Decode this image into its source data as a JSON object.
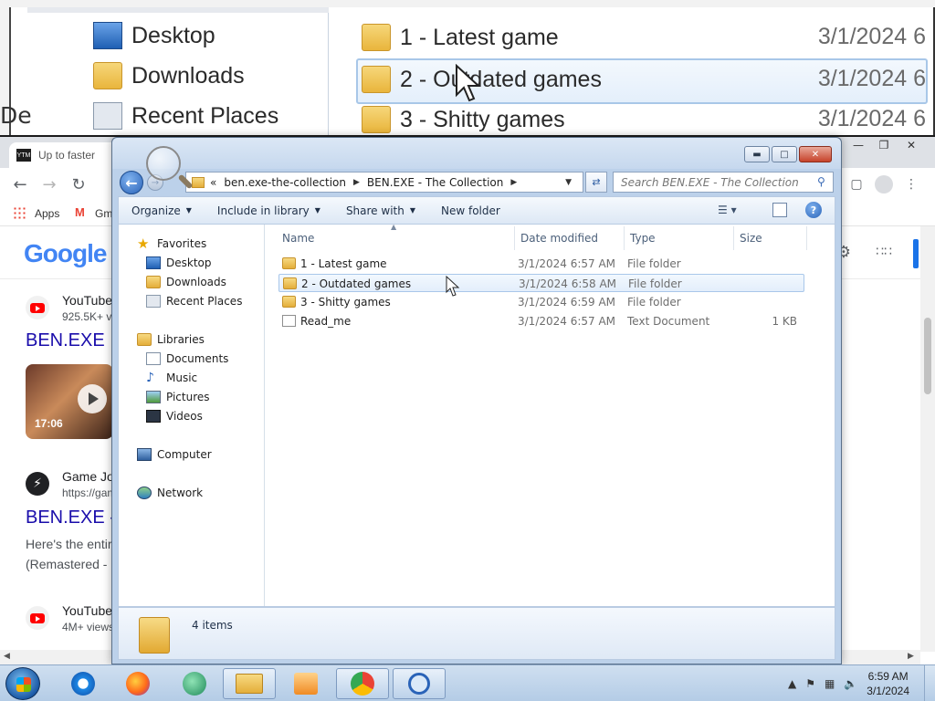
{
  "zoom": {
    "nav_items": [
      "Desktop",
      "Downloads",
      "Recent Places"
    ],
    "files": [
      "1 - Latest game",
      "2 - Outdated games",
      "3 - Shitty games"
    ],
    "date_fragment": "3/1/2024 6",
    "left_fragment": "De"
  },
  "browser": {
    "tab_title": "Up to faster",
    "tab_favicon": "YTM",
    "bookmarks": [
      "Apps",
      "Gm"
    ],
    "google_logo": "Google",
    "results": {
      "r1_source": "YouTube",
      "r1_meta": "925.5K+ v",
      "r1_title": "BEN.EXE",
      "video_duration": "17:06",
      "r2_source": "Game Jo",
      "r2_url": "https://gam",
      "r2_title": "BEN.EXE -",
      "r2_snippet1": "Here's the entir",
      "r2_snippet2": "(Remastered -",
      "r3_source": "YouTube",
      "r3_meta": "4M+ views"
    }
  },
  "explorer": {
    "breadcrumb": [
      "«",
      "ben.exe-the-collection",
      "BEN.EXE - The Collection"
    ],
    "search_placeholder": "Search BEN.EXE - The Collection",
    "toolbar": {
      "organize": "Organize",
      "include": "Include in library",
      "share": "Share with",
      "new_folder": "New folder"
    },
    "nav": {
      "favorites": "Favorites",
      "desktop": "Desktop",
      "downloads": "Downloads",
      "recent": "Recent Places",
      "libraries": "Libraries",
      "documents": "Documents",
      "music": "Music",
      "pictures": "Pictures",
      "videos": "Videos",
      "computer": "Computer",
      "network": "Network"
    },
    "columns": {
      "name": "Name",
      "date": "Date modified",
      "type": "Type",
      "size": "Size"
    },
    "files": [
      {
        "name": "1 - Latest game",
        "date": "3/1/2024 6:57 AM",
        "type": "File folder",
        "size": ""
      },
      {
        "name": "2 - Outdated games",
        "date": "3/1/2024 6:58 AM",
        "type": "File folder",
        "size": ""
      },
      {
        "name": "3 - Shitty games",
        "date": "3/1/2024 6:59 AM",
        "type": "File folder",
        "size": ""
      },
      {
        "name": "Read_me",
        "date": "3/1/2024 6:57 AM",
        "type": "Text Document",
        "size": "1 KB"
      }
    ],
    "status": "4 items"
  },
  "taskbar": {
    "time": "6:59 AM",
    "date": "3/1/2024"
  },
  "colors": {
    "accent": "#1a0dab",
    "selection": "#e3eefb",
    "folder": "#e9b53c"
  }
}
